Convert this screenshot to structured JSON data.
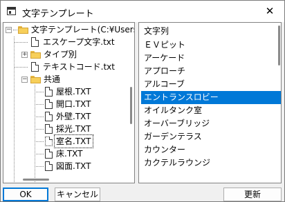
{
  "window": {
    "title": "文字テンプレート",
    "close_glyph": "✕"
  },
  "tree": {
    "root_label": "文字テンプレート(C:¥Users¥",
    "items": [
      {
        "label": "エスケープ文字.txt"
      },
      {
        "label": "タイプ別"
      },
      {
        "label": "テキストコード.txt"
      },
      {
        "label": "共通"
      },
      {
        "label": "屋根.TXT"
      },
      {
        "label": "開口.TXT"
      },
      {
        "label": "外壁.TXT"
      },
      {
        "label": "採光.TXT"
      },
      {
        "label": "室名.TXT"
      },
      {
        "label": "床.TXT"
      },
      {
        "label": "図面.TXT"
      }
    ],
    "expander_collapsed": "+",
    "expander_expanded": "−"
  },
  "list": {
    "items": [
      "文字列",
      "ＥＶピット",
      "アーケード",
      "アプローチ",
      "アルコーブ",
      "エントランスロビー",
      "オイルタンク室",
      "オーバーブリッジ",
      "ガーデンテラス",
      "カウンター",
      "カクテルラウンジ"
    ],
    "selected_index": 5
  },
  "buttons": {
    "ok": "OK",
    "cancel": "キャンセル",
    "update": "更新"
  },
  "colors": {
    "selection": "#0078d7",
    "folder": "#f7cf5a"
  }
}
